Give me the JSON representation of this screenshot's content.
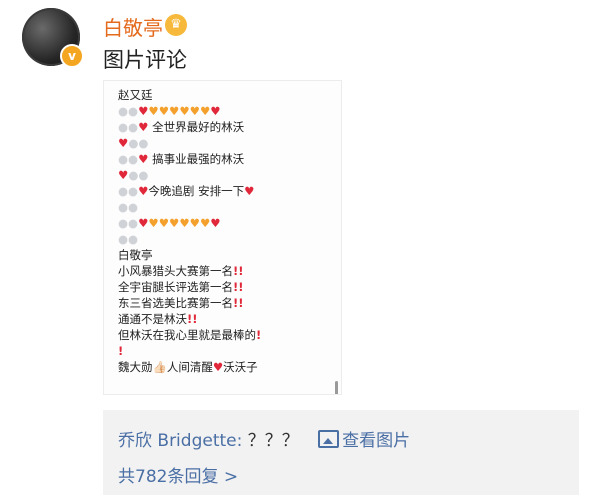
{
  "post": {
    "username": "白敬亭",
    "crown_icon": "crown-icon",
    "badge_icon": "verified-badge-icon",
    "comment": "图片评论"
  },
  "image": {
    "lines": [
      {
        "text": "赵又廷"
      },
      {
        "text": "⚪⚪❤🧡🧡🧡🧡🧡🧡❤"
      },
      {
        "text": "⚪⚪❤ 全世界最好的林沃"
      },
      {
        "text": "❤⚪⚪"
      },
      {
        "text": "⚪⚪❤ 搞事业最强的林沃"
      },
      {
        "text": "❤⚪⚪"
      },
      {
        "text": "⚪⚪❤今晚追剧  安排一下❤"
      },
      {
        "text": "⚪⚪"
      },
      {
        "text": "⚪⚪❤🧡🧡🧡🧡🧡🧡❤"
      },
      {
        "text": "⚪⚪"
      },
      {
        "text": "白敬亭"
      },
      {
        "text": "小风暴猎头大赛第一名❗❗"
      },
      {
        "text": "全宇宙腿长评选第一名❗❗"
      },
      {
        "text": "东三省选美比赛第一名❗❗"
      },
      {
        "text": "通通不是林沃❗❗"
      },
      {
        "text": "但林沃在我心里就是最棒的❗"
      },
      {
        "text": "❗"
      },
      {
        "text": "魏大勋👍🏻人间清醒❤沃沃子"
      }
    ]
  },
  "footer": {
    "reply_user": "乔欣 Bridgette:",
    "reply_text": "？？？",
    "view_image": "查看图片",
    "view_icon": "image-icon",
    "total_replies": "共782条回复 >"
  }
}
